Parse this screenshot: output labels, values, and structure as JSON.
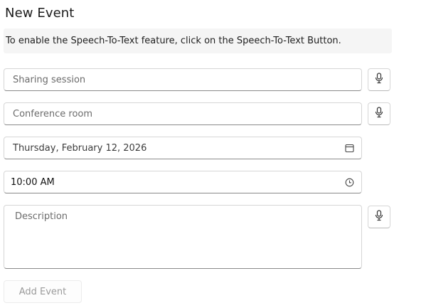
{
  "page": {
    "title": "New Event",
    "banner": "To enable the Speech-To-Text feature, click on the Speech-To-Text Button."
  },
  "form": {
    "subject": {
      "value": "",
      "placeholder": "Sharing session"
    },
    "location": {
      "value": "",
      "placeholder": "Conference room"
    },
    "date": {
      "value": "Thursday, February 12, 2026",
      "icon": "calendar-icon"
    },
    "time": {
      "value": "10:00 AM",
      "icon": "clock-icon"
    },
    "description": {
      "value": "",
      "placeholder": "Description"
    },
    "mic_icon": "microphone-icon",
    "submit_label": "Add Event"
  }
}
